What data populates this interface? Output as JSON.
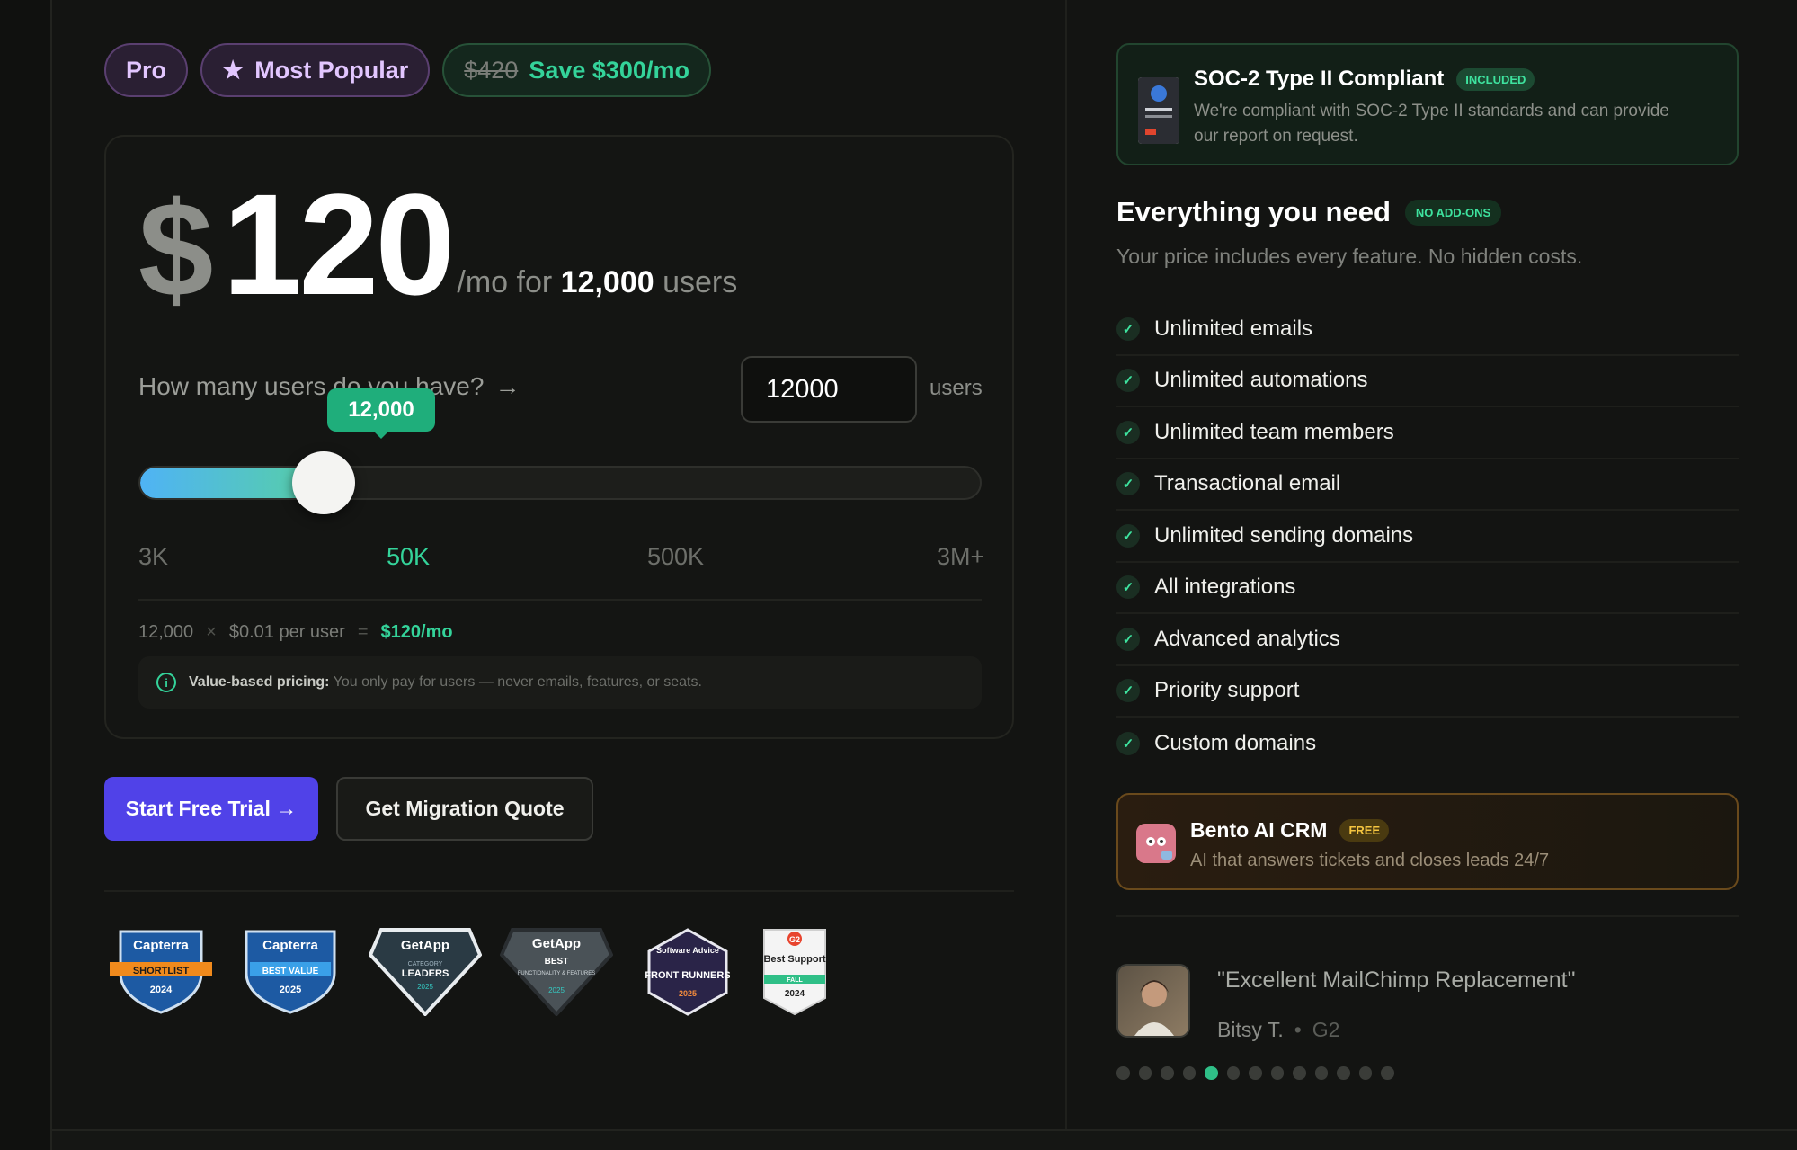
{
  "pills": {
    "plan": "Pro",
    "popular": "Most Popular",
    "old_price": "$420",
    "save": "Save $300/mo"
  },
  "price": {
    "currency": "$",
    "amount": "120",
    "per": "/mo for",
    "users": "12,000",
    "users_suffix": "users"
  },
  "slider": {
    "question": "How many users do you have?",
    "input_value": "12000",
    "input_suffix": "users",
    "bubble": "12,000",
    "position_fraction": 0.22,
    "ticks": [
      "3K",
      "50K",
      "500K",
      "3M+"
    ],
    "active_tick": "50K"
  },
  "calc": {
    "users": "12,000",
    "times": "×",
    "rate": "$0.01 per user",
    "equals": "=",
    "total": "$120/mo"
  },
  "note": {
    "bold": "Value-based pricing:",
    "text": "You only pay for users — never emails, features, or seats."
  },
  "cta": {
    "primary": "Start Free Trial →",
    "secondary": "Get Migration Quote"
  },
  "badges": [
    {
      "brand": "Capterra",
      "label": "SHORTLIST",
      "year": "2024"
    },
    {
      "brand": "Capterra",
      "label": "BEST VALUE",
      "year": "2025"
    },
    {
      "brand": "GetApp",
      "label": "LEADERS",
      "sub": "CATEGORY",
      "year": "2025"
    },
    {
      "brand": "GetApp",
      "label": "BEST",
      "sub": "FUNCTIONALITY & FEATURES",
      "year": "2025"
    },
    {
      "brand": "Software Advice",
      "label": "FRONT RUNNERS",
      "year": "2025"
    },
    {
      "brand": "G2",
      "label": "Best Support",
      "sub": "FALL",
      "year": "2024"
    }
  ],
  "soc": {
    "title": "SOC-2 Type II Compliant",
    "tag": "INCLUDED",
    "desc": "We're compliant with SOC-2 Type II standards and can provide our report on request."
  },
  "need": {
    "title": "Everything you need",
    "tag": "NO ADD-ONS",
    "sub": "Your price includes every feature. No hidden costs."
  },
  "features": [
    "Unlimited emails",
    "Unlimited automations",
    "Unlimited team members",
    "Transactional email",
    "Unlimited sending domains",
    "All integrations",
    "Advanced analytics",
    "Priority support",
    "Custom domains"
  ],
  "crm": {
    "title": "Bento AI CRM",
    "tag": "FREE",
    "desc": "AI that answers tickets and closes leads 24/7"
  },
  "testimonial": {
    "quote": "\"Excellent MailChimp Replacement\"",
    "author": "Bitsy T.",
    "dot": "•",
    "source": "G2"
  },
  "carousel": {
    "count": 13,
    "active": 4
  },
  "colors": {
    "accent": "#5042e8",
    "green": "#34d39a",
    "gold": "#f5c540"
  }
}
